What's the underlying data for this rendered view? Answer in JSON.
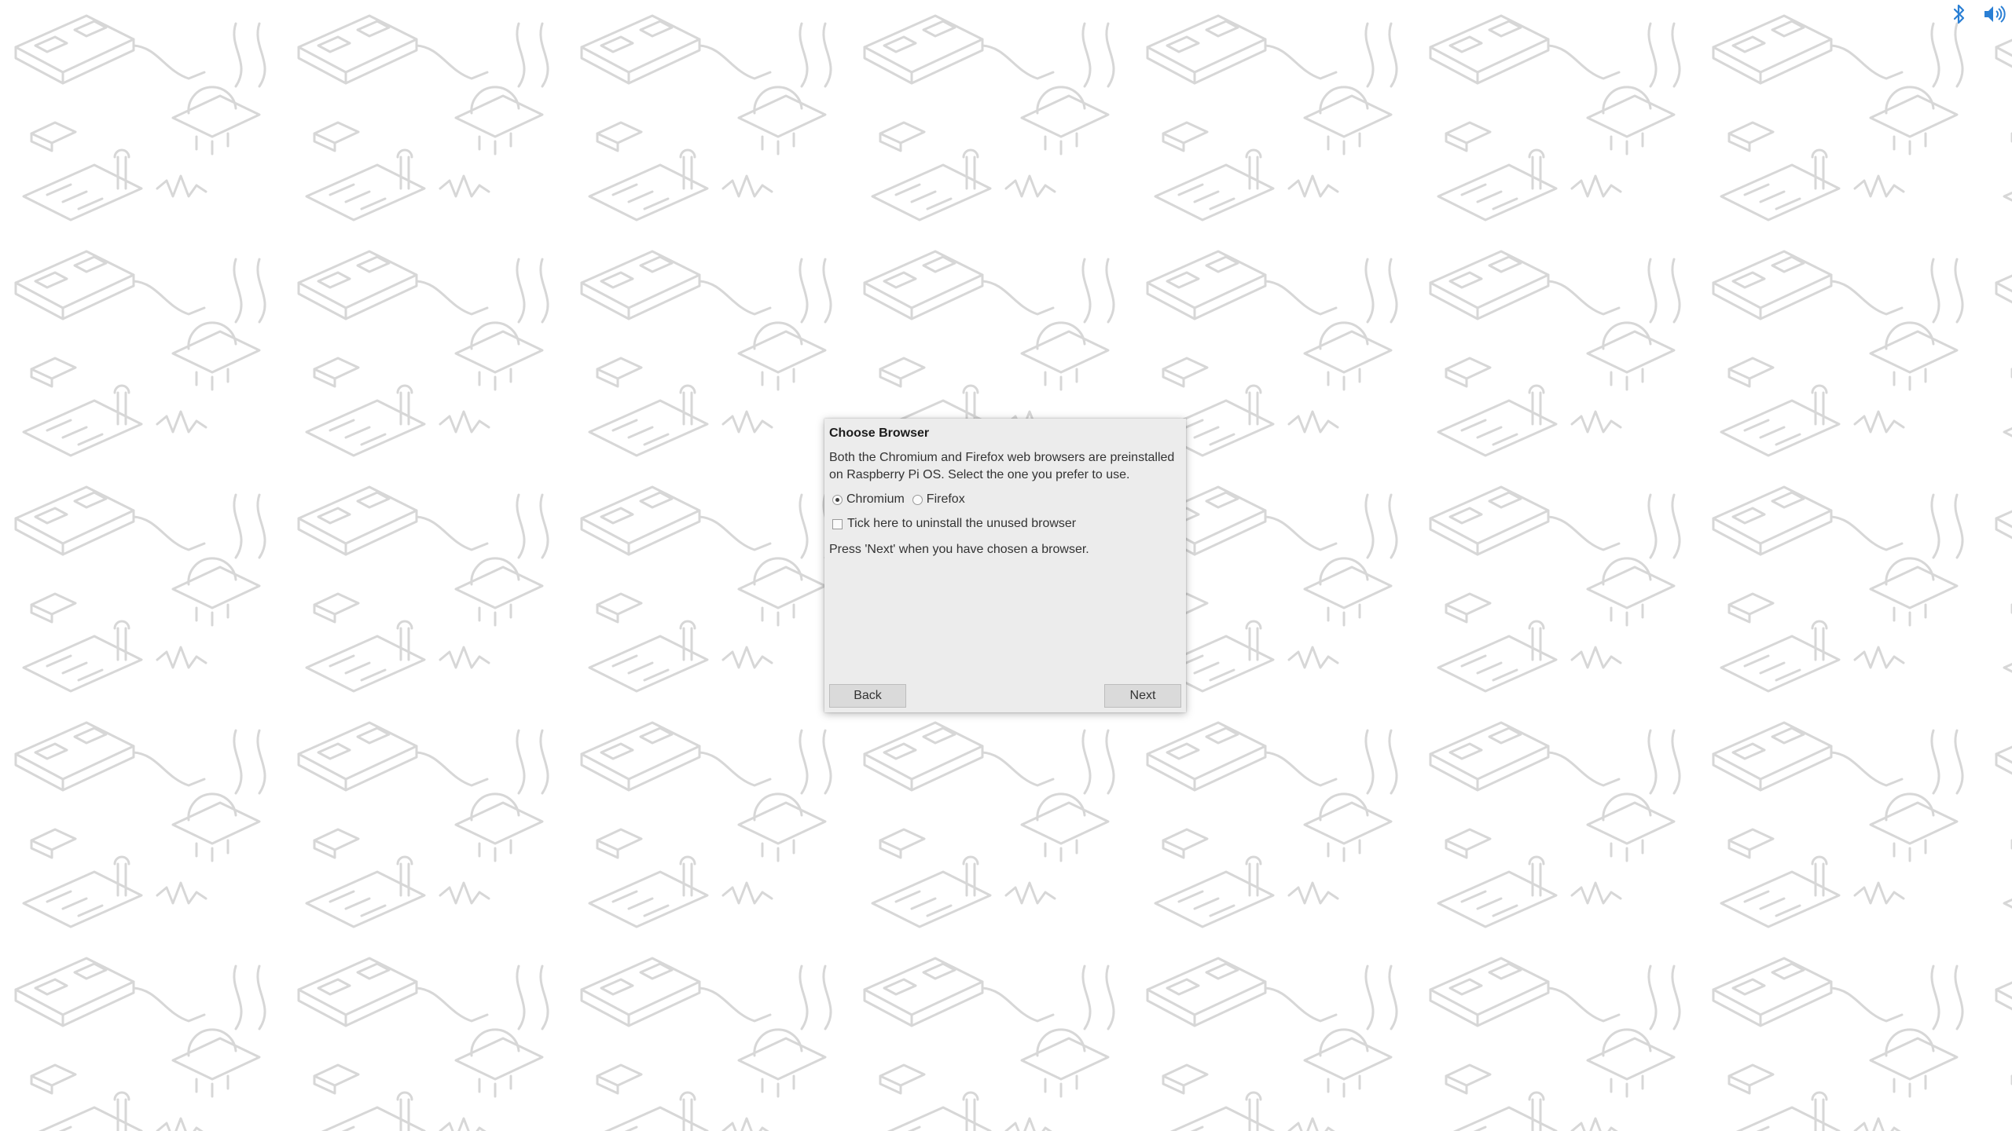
{
  "system_tray": {
    "icons": [
      "bluetooth-icon",
      "volume-icon"
    ],
    "accent_color": "#2a7fd4"
  },
  "dialog": {
    "title": "Choose Browser",
    "description": "Both the Chromium and Firefox web browsers are preinstalled on Raspberry Pi OS. Select the one you prefer to use.",
    "browser_options": [
      {
        "label": "Chromium",
        "selected": true
      },
      {
        "label": "Firefox",
        "selected": false
      }
    ],
    "uninstall_checkbox": {
      "label": "Tick here to uninstall the unused browser",
      "checked": false
    },
    "note": "Press 'Next' when you have chosen a browser.",
    "back_label": "Back",
    "next_label": "Next"
  }
}
